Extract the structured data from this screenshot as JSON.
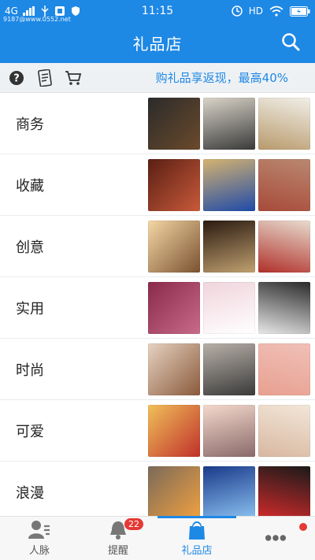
{
  "status_bar": {
    "network": "4G",
    "time": "11:15",
    "hd": "HD",
    "tiny_text": "9187@www.0552.net"
  },
  "app_bar": {
    "title": "礼品店",
    "search_icon": "search-icon"
  },
  "toolbar": {
    "icons": [
      "help-icon",
      "receipt-icon",
      "cart-icon"
    ],
    "promo": "购礼品享返现，最高40%"
  },
  "categories": [
    {
      "label": "商务",
      "thumb_colors": [
        [
          "#2b2b2b",
          "#6b4a2b"
        ],
        [
          "#d9d4c8",
          "#3a3a3a"
        ],
        [
          "#f1efe8",
          "#b89a6c"
        ]
      ]
    },
    {
      "label": "收藏",
      "thumb_colors": [
        [
          "#5a1f14",
          "#c85a3a"
        ],
        [
          "#d4b370",
          "#1f4aa8"
        ],
        [
          "#b98870",
          "#a84a3a"
        ]
      ]
    },
    {
      "label": "创意",
      "thumb_colors": [
        [
          "#f5d7a6",
          "#7a5230"
        ],
        [
          "#2a1a10",
          "#c0a070"
        ],
        [
          "#e8dccf",
          "#b0302a"
        ]
      ]
    },
    {
      "label": "实用",
      "thumb_colors": [
        [
          "#8a2a4a",
          "#c86a8a"
        ],
        [
          "#f0d4dc",
          "#ffffff"
        ],
        [
          "#2a2a2a",
          "#e8e8e8"
        ]
      ]
    },
    {
      "label": "时尚",
      "thumb_colors": [
        [
          "#e6d2c2",
          "#8a5a3a"
        ],
        [
          "#b8b0a8",
          "#3a3a3a"
        ],
        [
          "#f0c0b8",
          "#e8a090"
        ]
      ]
    },
    {
      "label": "可爱",
      "thumb_colors": [
        [
          "#f0c05a",
          "#c0302a"
        ],
        [
          "#f4d8cc",
          "#8a6a6a"
        ],
        [
          "#f2e6d8",
          "#d8b8a0"
        ]
      ]
    },
    {
      "label": "浪漫",
      "thumb_colors": [
        [
          "#7a6a5a",
          "#f0a040"
        ],
        [
          "#1a3a8a",
          "#8ac0f0"
        ],
        [
          "#1a1a1a",
          "#d02a2a"
        ]
      ]
    }
  ],
  "bottom_nav": [
    {
      "label": "人脉",
      "icon": "contacts-icon",
      "badge": ""
    },
    {
      "label": "提醒",
      "icon": "bell-icon",
      "badge": "22"
    },
    {
      "label": "礼品店",
      "icon": "gift-bag-icon",
      "badge": ""
    },
    {
      "label": "",
      "icon": "more-icon",
      "badge": "dot"
    }
  ],
  "colors": {
    "primary": "#1e88e5",
    "badge": "#e53935"
  }
}
